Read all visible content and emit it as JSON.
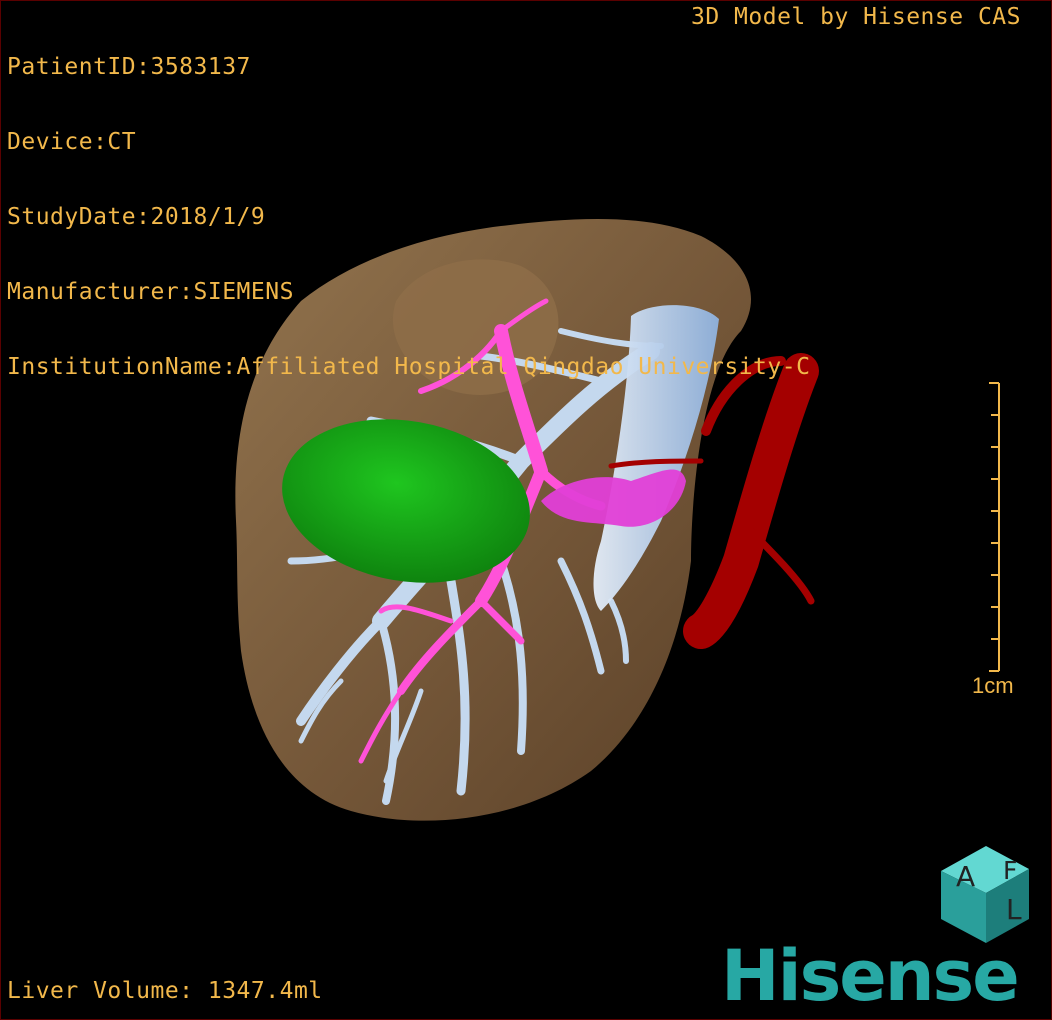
{
  "header": {
    "patient_id": "PatientID:3583137",
    "device": "Device:CT",
    "study_date": "StudyDate:2018/1/9",
    "manufacturer": "Manufacturer:SIEMENS",
    "institution": "InstitutionName:Affiliated Hospital Qingdao University-C",
    "credit": "3D Model by Hisense CAS"
  },
  "footer": {
    "volume": "Liver Volume: 1347.4ml"
  },
  "scale_bar": {
    "label": "1cm"
  },
  "branding": {
    "logo_text": "Hisense",
    "cube_letters": [
      "A",
      "F",
      "L"
    ]
  },
  "colors": {
    "text": "#f2b84b",
    "liver": "#7a5b3b",
    "tumor": "#14a314",
    "portal": "#ff52d8",
    "vein": "#c4d8ee",
    "artery": "#a40000",
    "brand": "#27a8a4"
  }
}
